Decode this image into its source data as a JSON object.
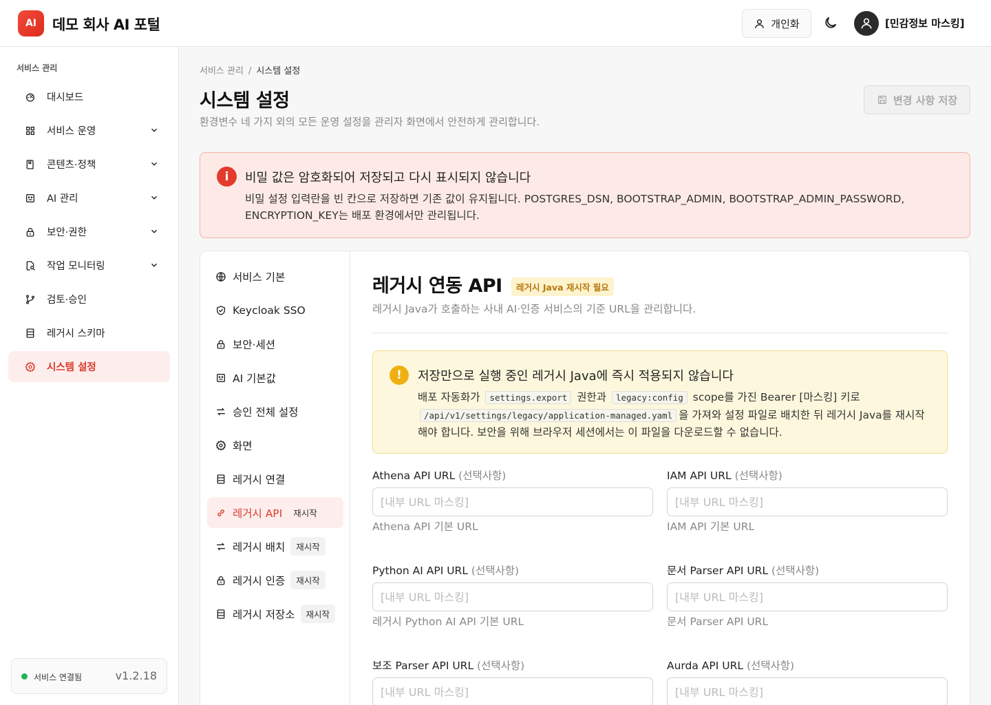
{
  "header": {
    "logo_text": "AI",
    "app_title": "데모 회사 AI 포털",
    "personal_label": "개인화",
    "user_name": "[민감정보 마스킹]"
  },
  "sidebar": {
    "section_title": "서비스 관리",
    "items": [
      {
        "label": "대시보드",
        "icon": "dashboard-icon",
        "expandable": false
      },
      {
        "label": "서비스 운영",
        "icon": "grid-icon",
        "expandable": true
      },
      {
        "label": "콘텐츠·정책",
        "icon": "book-icon",
        "expandable": true
      },
      {
        "label": "AI 관리",
        "icon": "bot-icon",
        "expandable": true
      },
      {
        "label": "보안·권한",
        "icon": "lock-icon",
        "expandable": true
      },
      {
        "label": "작업 모니터링",
        "icon": "monitor-search-icon",
        "expandable": true
      },
      {
        "label": "검토·승인",
        "icon": "git-branch-icon",
        "expandable": false
      },
      {
        "label": "레거시 스키마",
        "icon": "schema-icon",
        "expandable": false
      },
      {
        "label": "시스템 설정",
        "icon": "gear-icon",
        "expandable": false,
        "active": true
      }
    ],
    "status_text": "서비스 연결됨",
    "version": "v1.2.18"
  },
  "page": {
    "breadcrumb_parent": "서비스 관리",
    "breadcrumb_separator": "/",
    "breadcrumb_current": "시스템 설정",
    "title": "시스템 설정",
    "description": "환경변수 네 가지 외의 모든 운영 설정을 관리자 화면에서 안전하게 관리합니다.",
    "save_label": "변경 사항 저장"
  },
  "secret_alert": {
    "icon": "i",
    "title": "비밀 값은 암호화되어 저장되고 다시 표시되지 않습니다",
    "body": "비밀 설정 입력란을 빈 칸으로 저장하면 기존 값이 유지됩니다. POSTGRES_DSN, BOOTSTRAP_ADMIN, BOOTSTRAP_ADMIN_PASSWORD, ENCRYPTION_KEY는 배포 환경에서만 관리됩니다."
  },
  "subnav": {
    "items": [
      {
        "label": "서비스 기본",
        "icon": "globe-icon"
      },
      {
        "label": "Keycloak SSO",
        "icon": "shield-check-icon"
      },
      {
        "label": "보안·세션",
        "icon": "lock-icon"
      },
      {
        "label": "AI 기본값",
        "icon": "bot-icon"
      },
      {
        "label": "승인 전체 설정",
        "icon": "arrows-swap-icon"
      },
      {
        "label": "화면",
        "icon": "gear-icon"
      },
      {
        "label": "레거시 연결",
        "icon": "schema-icon"
      },
      {
        "label": "레거시 API",
        "icon": "link-icon",
        "badge": "재시작",
        "active": true
      },
      {
        "label": "레거시 배치",
        "icon": "arrows-swap-icon",
        "badge": "재시작"
      },
      {
        "label": "레거시 인증",
        "icon": "lock-icon",
        "badge": "재시작"
      },
      {
        "label": "레거시 저장소",
        "icon": "schema-icon",
        "badge": "재시작"
      }
    ]
  },
  "section": {
    "title": "레거시 연동 API",
    "badge": "레거시 Java 재시작 필요",
    "description": "레거시 Java가 호출하는 사내 AI·인증 서비스의 기준 URL을 관리합니다."
  },
  "apply_alert": {
    "icon": "!",
    "title": "저장만으로 실행 중인 레거시 Java에 즉시 적용되지 않습니다",
    "body_1": "배포 자동화가",
    "code_1": "settings.export",
    "body_2": "권한과",
    "code_2": "legacy:config",
    "body_3": "scope를 가진 Bearer [마스킹] 키로",
    "code_3": "/api/v1/settings/legacy/application-managed.yaml",
    "body_4": "을 가져와 설정 파일로 배치한 뒤 레거시 Java를 재시작해야 합니다. 보안을 위해 브라우저 세션에서는 이 파일을 다운로드할 수 없습니다."
  },
  "fields": [
    {
      "label": "Athena API URL",
      "optional": "(선택사항)",
      "placeholder": "[내부 URL 마스킹]",
      "help": "Athena API 기본 URL"
    },
    {
      "label": "IAM API URL",
      "optional": "(선택사항)",
      "placeholder": "[내부 URL 마스킹]",
      "help": "IAM API 기본 URL"
    },
    {
      "label": "Python AI API URL",
      "optional": "(선택사항)",
      "placeholder": "[내부 URL 마스킹]",
      "help": "레거시 Python AI API 기본 URL"
    },
    {
      "label": "문서 Parser API URL",
      "optional": "(선택사항)",
      "placeholder": "[내부 URL 마스킹]",
      "help": "문서 Parser API URL"
    },
    {
      "label": "보조 Parser API URL",
      "optional": "(선택사항)",
      "placeholder": "[내부 URL 마스킹]",
      "help": ""
    },
    {
      "label": "Aurda API URL",
      "optional": "(선택사항)",
      "placeholder": "[내부 URL 마스킹]",
      "help": ""
    }
  ],
  "colors": {
    "accent": "#dc3a2b",
    "active_bg": "#fdeeed",
    "danger_alert_bg": "#fdeae6",
    "warning_alert_bg": "#fdf8dd",
    "status_ok": "#22b455"
  }
}
